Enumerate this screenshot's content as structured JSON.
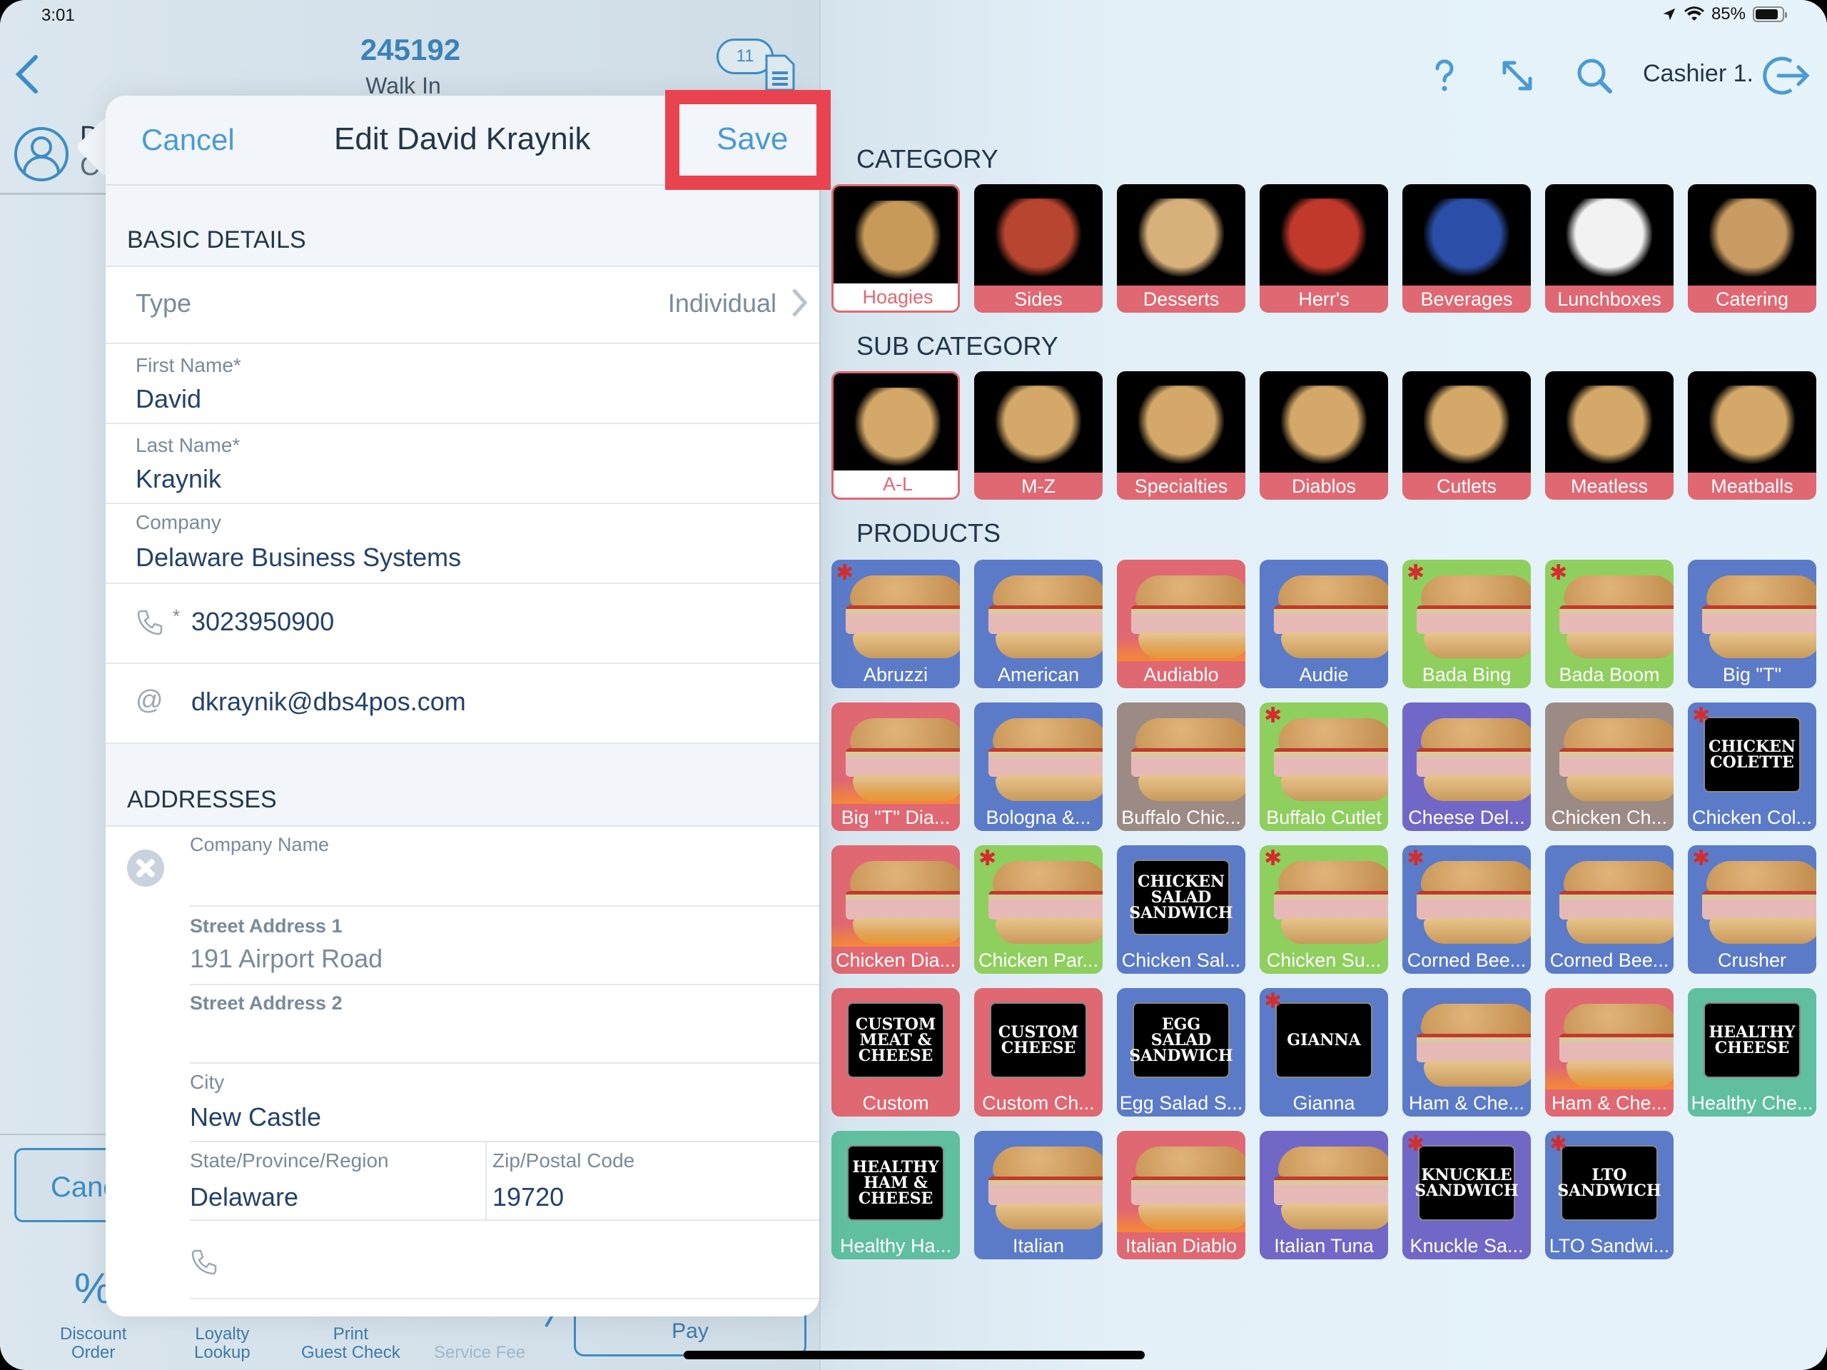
{
  "status_bar": {
    "time": "3:01",
    "battery_text": "85%",
    "battery_level": 0.85,
    "icons": [
      "location-arrow-icon",
      "wifi-icon",
      "battery-icon"
    ]
  },
  "order_header": {
    "order_number": "245192",
    "order_type": "Walk In",
    "ticket_count": "11"
  },
  "customer_behind": {
    "initial_line1": "D",
    "initial_line2": "C"
  },
  "toolbar": {
    "help_icon": "question-icon",
    "resize_icon": "resize-arrows-icon",
    "search_icon": "search-icon",
    "cashier_label": "Cashier 1.",
    "logout_icon": "logout-icon"
  },
  "modal": {
    "cancel_label": "Cancel",
    "title": "Edit David Kraynik",
    "save_label": "Save",
    "basic_details": {
      "section_title": "BASIC DETAILS",
      "type_label": "Type",
      "type_value": "Individual",
      "first_name_label": "First Name*",
      "first_name_value": "David",
      "last_name_label": "Last Name*",
      "last_name_value": "Kraynik",
      "company_label": "Company",
      "company_value": "Delaware Business Systems",
      "phone_required_mark": "*",
      "phone_value": "3023950900",
      "email_value": "dkraynik@dbs4pos.com"
    },
    "addresses": {
      "section_title": "ADDRESSES",
      "company_name_label": "Company Name",
      "company_name_value": "",
      "street1_label": "Street Address 1",
      "street1_value": "191 Airport Road",
      "street2_label": "Street Address 2",
      "street2_value": "",
      "city_label": "City",
      "city_value": "New Castle",
      "state_label": "State/Province/Region",
      "state_value": "Delaware",
      "zip_label": "Zip/Postal Code",
      "zip_value": "19720",
      "phone_value": ""
    }
  },
  "bottom_bar": {
    "cancel_partial": "Canc",
    "discount_label_1": "Discount",
    "discount_label_2": "Order",
    "loyalty_label_1": "Loyalty",
    "loyalty_label_2": "Lookup",
    "print_label_1": "Print",
    "print_label_2": "Guest Check",
    "service_fee_label": "Service Fee",
    "pay_label": "Pay"
  },
  "menu": {
    "category_title": "CATEGORY",
    "categories": [
      {
        "label": "Hoagies",
        "selected": true
      },
      {
        "label": "Sides",
        "selected": false
      },
      {
        "label": "Desserts",
        "selected": false
      },
      {
        "label": "Herr's",
        "selected": false
      },
      {
        "label": "Beverages",
        "selected": false
      },
      {
        "label": "Lunchboxes",
        "selected": false
      },
      {
        "label": "Catering",
        "selected": false
      }
    ],
    "subcategory_title": "SUB CATEGORY",
    "subcategories": [
      {
        "label": "A-L",
        "selected": true
      },
      {
        "label": "M-Z",
        "selected": false
      },
      {
        "label": "Specialties",
        "selected": false
      },
      {
        "label": "Diablos",
        "selected": false
      },
      {
        "label": "Cutlets",
        "selected": false
      },
      {
        "label": "Meatless",
        "selected": false
      },
      {
        "label": "Meatballs",
        "selected": false
      }
    ],
    "products_title": "PRODUCTS",
    "colors": {
      "blue": "#5b7bc9",
      "red": "#e06872",
      "green": "#8fcf5e",
      "taupe": "#9c8a84",
      "purple": "#7167c6",
      "teal": "#5fbf9e",
      "accent": "#4a9bd3",
      "highlight": "#e8434f"
    },
    "products": [
      {
        "label": "Abruzzi",
        "color": "blue",
        "asterisk": true,
        "art": "sandwich"
      },
      {
        "label": "American",
        "color": "blue",
        "asterisk": false,
        "art": "sandwich"
      },
      {
        "label": "Audiablo",
        "color": "red",
        "asterisk": false,
        "art": "sandwich",
        "flames": true
      },
      {
        "label": "Audie",
        "color": "blue",
        "asterisk": false,
        "art": "sandwich"
      },
      {
        "label": "Bada Bing",
        "color": "green",
        "asterisk": true,
        "art": "sandwich"
      },
      {
        "label": "Bada Boom",
        "color": "green",
        "asterisk": true,
        "art": "sandwich"
      },
      {
        "label": "Big \"T\"",
        "color": "blue",
        "asterisk": false,
        "art": "sandwich"
      },
      {
        "label": "Big \"T\" Dia...",
        "color": "red",
        "asterisk": false,
        "art": "sandwich",
        "flames": true
      },
      {
        "label": "Bologna &...",
        "color": "blue",
        "asterisk": false,
        "art": "sandwich"
      },
      {
        "label": "Buffalo Chic...",
        "color": "taupe",
        "asterisk": false,
        "art": "sandwich"
      },
      {
        "label": "Buffalo Cutlet",
        "color": "green",
        "asterisk": true,
        "art": "sandwich"
      },
      {
        "label": "Cheese Del...",
        "color": "purple",
        "asterisk": false,
        "art": "sandwich"
      },
      {
        "label": "Chicken Ch...",
        "color": "taupe",
        "asterisk": false,
        "art": "sandwich"
      },
      {
        "label": "Chicken Col...",
        "color": "blue",
        "asterisk": true,
        "art": "logo",
        "logo_text": "CHICKEN\nCOLETTE"
      },
      {
        "label": "Chicken Dia...",
        "color": "red",
        "asterisk": false,
        "art": "sandwich",
        "flames": true
      },
      {
        "label": "Chicken Par...",
        "color": "green",
        "asterisk": true,
        "art": "sandwich"
      },
      {
        "label": "Chicken Sal...",
        "color": "blue",
        "asterisk": false,
        "art": "logo",
        "logo_text": "CHICKEN\nSALAD\nSANDWICH"
      },
      {
        "label": "Chicken Su...",
        "color": "green",
        "asterisk": true,
        "art": "sandwich"
      },
      {
        "label": "Corned Bee...",
        "color": "blue",
        "asterisk": true,
        "art": "sandwich"
      },
      {
        "label": "Corned Bee...",
        "color": "blue",
        "asterisk": false,
        "art": "sandwich"
      },
      {
        "label": "Crusher",
        "color": "blue",
        "asterisk": true,
        "art": "sandwich"
      },
      {
        "label": "Custom",
        "color": "red",
        "asterisk": false,
        "art": "logo",
        "logo_text": "CUSTOM\nMEAT &\nCHEESE"
      },
      {
        "label": "Custom Ch...",
        "color": "red",
        "asterisk": false,
        "art": "logo",
        "logo_text": "CUSTOM\nCHEESE"
      },
      {
        "label": "Egg Salad S...",
        "color": "blue",
        "asterisk": false,
        "art": "logo",
        "logo_text": "EGG SALAD\nSANDWICH"
      },
      {
        "label": "Gianna",
        "color": "blue",
        "asterisk": true,
        "art": "logo",
        "logo_text": "GIANNA"
      },
      {
        "label": "Ham & Che...",
        "color": "blue",
        "asterisk": false,
        "art": "sandwich"
      },
      {
        "label": "Ham & Che...",
        "color": "red",
        "asterisk": false,
        "art": "sandwich",
        "flames": true
      },
      {
        "label": "Healthy Che...",
        "color": "teal",
        "asterisk": false,
        "art": "logo",
        "logo_text": "HEALTHY\nCHEESE"
      },
      {
        "label": "Healthy Ha...",
        "color": "teal",
        "asterisk": false,
        "art": "logo",
        "logo_text": "HEALTHY\nHAM &\nCHEESE"
      },
      {
        "label": "Italian",
        "color": "blue",
        "asterisk": false,
        "art": "sandwich"
      },
      {
        "label": "Italian Diablo",
        "color": "red",
        "asterisk": false,
        "art": "sandwich",
        "flames": true
      },
      {
        "label": "Italian Tuna",
        "color": "purple",
        "asterisk": false,
        "art": "sandwich"
      },
      {
        "label": "Knuckle Sa...",
        "color": "purple",
        "asterisk": true,
        "art": "logo",
        "logo_text": "KNUCKLE\nSANDWICH"
      },
      {
        "label": "LTO Sandwi...",
        "color": "blue",
        "asterisk": true,
        "art": "logo",
        "logo_text": "LTO\nSANDWICH"
      }
    ]
  }
}
